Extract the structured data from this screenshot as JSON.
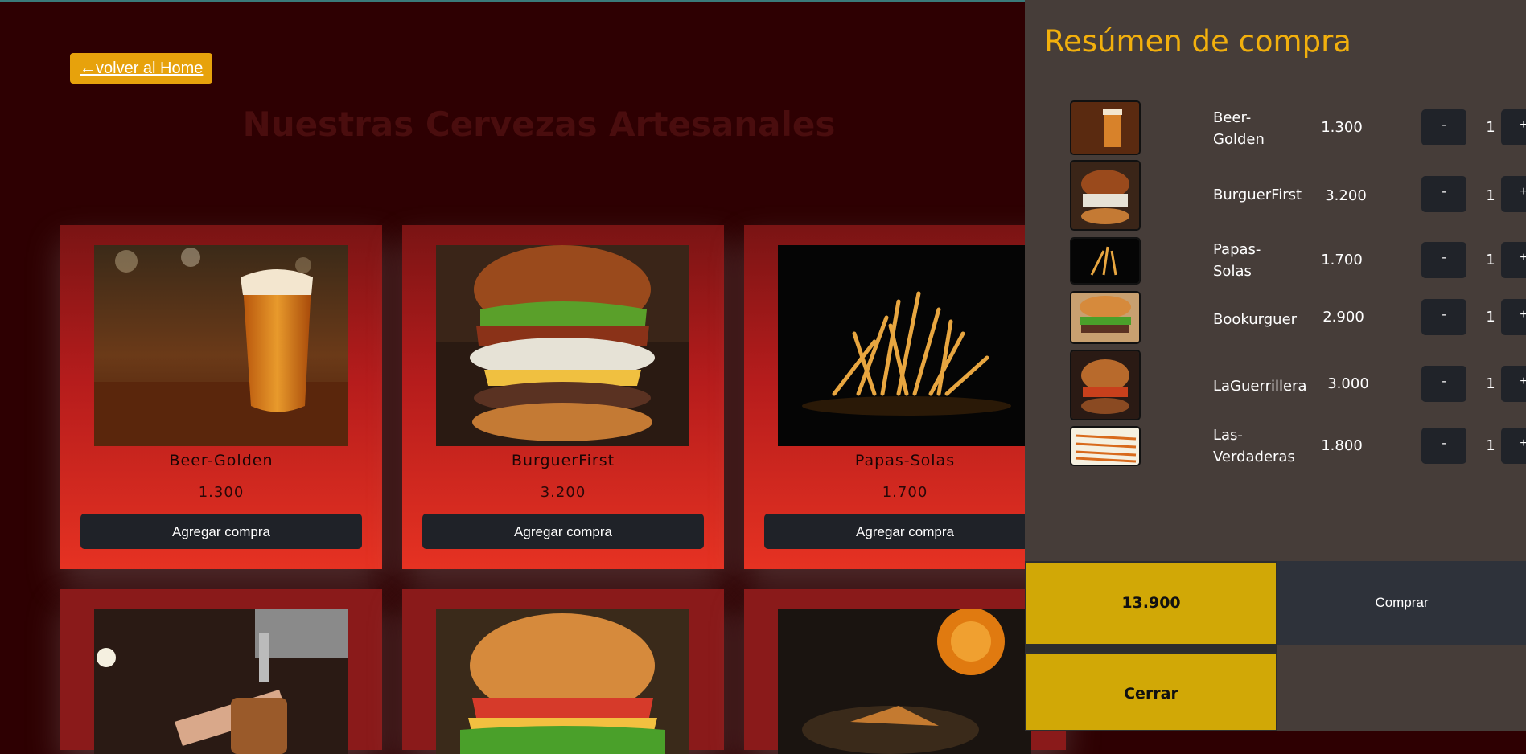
{
  "nav": {
    "back_label": "←volver al Home"
  },
  "page": {
    "title": "Nuestras Cervezas Artesanales"
  },
  "products": [
    {
      "name": "Beer-Golden",
      "price": "1.300",
      "button": "Agregar compra",
      "image": "beer-glass-image"
    },
    {
      "name": "BurguerFirst",
      "price": "3.200",
      "button": "Agregar compra",
      "image": "burger-image"
    },
    {
      "name": "Papas-Solas",
      "price": "1.700",
      "button": "Agregar compra",
      "image": "fries-image"
    }
  ],
  "cart": {
    "title": "Resúmen de compra",
    "items": [
      {
        "name": "Beer-\nGolden",
        "price": "1.300",
        "qty": "1",
        "minus": "-",
        "plus": "+"
      },
      {
        "name": "BurguerFirst",
        "price": "3.200",
        "qty": "1",
        "minus": "-",
        "plus": "+"
      },
      {
        "name": "Papas-\nSolas",
        "price": "1.700",
        "qty": "1",
        "minus": "-",
        "plus": "+"
      },
      {
        "name": "Bookurguer",
        "price": "2.900",
        "qty": "1",
        "minus": "-",
        "plus": "+"
      },
      {
        "name": "LaGuerrillera",
        "price": "3.000",
        "qty": "1",
        "minus": "-",
        "plus": "+"
      },
      {
        "name": "Las-\nVerdaderas",
        "price": "1.800",
        "qty": "1",
        "minus": "-",
        "plus": "+"
      }
    ],
    "total": "13.900",
    "buy_label": "Comprar",
    "close_label": "Cerrar"
  },
  "colors": {
    "background": "#2e0002",
    "back_button": "#e7a20c",
    "panel": "#463d39",
    "panel_title": "#f2b00d",
    "total_bg": "#d1a806",
    "dark_button": "#202329"
  }
}
